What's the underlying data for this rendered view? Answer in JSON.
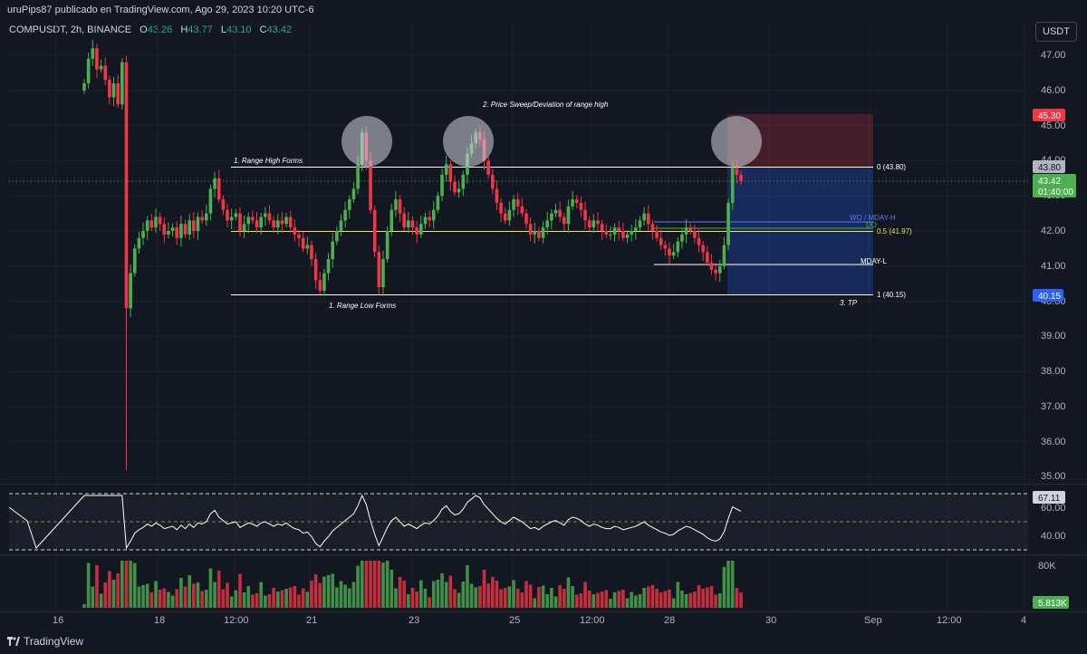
{
  "header": {
    "published_text": "uruPips87 publicado en TradingView.com, Ago 29, 2023 10:20 UTC-6",
    "symbol": "COMPUSDT, 2h, BINANCE",
    "ohlc": [
      {
        "k": "O",
        "v": "43.26"
      },
      {
        "k": "H",
        "v": "43.77"
      },
      {
        "k": "L",
        "v": "43.10"
      },
      {
        "k": "C",
        "v": "43.42"
      }
    ],
    "currency_button": "USDT"
  },
  "brand": {
    "name": "TradingView"
  },
  "colors": {
    "up": "#4caf50",
    "down": "#f23645",
    "background": "#131722",
    "accent": "#2962ff"
  },
  "price_axis": {
    "labels": [
      "47.00",
      "46.00",
      "45.00",
      "44.00",
      "43.00",
      "42.00",
      "41.00",
      "40.00",
      "39.00",
      "38.00",
      "37.00",
      "36.00",
      "35.00"
    ],
    "badges": {
      "stop": "45.30",
      "entry": "43.80",
      "last_price": "43.42",
      "countdown": "01:40:00",
      "target": "40.15"
    }
  },
  "time_axis": {
    "labels": [
      "16",
      "18",
      "12:00",
      "21",
      "23",
      "25",
      "12:00",
      "28",
      "30",
      "Sep",
      "12:00",
      "4"
    ]
  },
  "annotations": {
    "range_high": "1. Range High Forms",
    "range_low": "1. Range Low Forms",
    "sweep": "2. Price Sweep/Deviation of range high",
    "tp": "3. TP",
    "fib_0": "0 (43.80)",
    "fib_05": "0.5 (41.97)",
    "fib_1": "1 (40.15)",
    "wo_mday_h": "WO / MDAY-H",
    "do": "DO",
    "mday_l": "MDAY-L"
  },
  "rsi": {
    "labels": [
      "60.00",
      "40.00"
    ],
    "value": "67.11"
  },
  "volume": {
    "label": "80K",
    "value": "5.813K"
  },
  "chart_data": {
    "type": "candlestick",
    "symbol": "COMPUSDT",
    "timeframe": "2h",
    "exchange": "BINANCE",
    "ylim": [
      35.0,
      47.5
    ],
    "levels": {
      "range_high": 43.8,
      "equilibrium": 41.97,
      "range_low": 40.15,
      "stop": 45.3,
      "wo_mday_h": 42.25,
      "do": 42.05,
      "mday_l": 41.0
    },
    "close_series": [
      46.2,
      46.9,
      47.2,
      46.6,
      46.7,
      46.3,
      45.8,
      46.2,
      45.6,
      46.8,
      39.8,
      40.8,
      41.5,
      41.8,
      42.0,
      42.3,
      42.1,
      42.4,
      42.2,
      41.9,
      42.0,
      42.1,
      41.8,
      42.2,
      41.9,
      42.3,
      42.0,
      42.4,
      42.3,
      42.5,
      43.2,
      43.5,
      42.9,
      42.6,
      42.3,
      42.4,
      42.5,
      42.0,
      42.2,
      42.4,
      42.3,
      42.1,
      42.4,
      42.5,
      42.3,
      42.1,
      42.3,
      42.2,
      42.4,
      42.1,
      41.9,
      41.8,
      41.5,
      41.6,
      41.2,
      40.6,
      40.3,
      40.8,
      41.2,
      41.7,
      42.0,
      42.3,
      42.6,
      42.9,
      43.2,
      43.9,
      44.8,
      44.0,
      42.6,
      41.4,
      40.4,
      41.2,
      42.0,
      42.6,
      42.9,
      42.5,
      42.1,
      42.3,
      42.1,
      41.9,
      42.2,
      42.4,
      42.3,
      42.6,
      43.0,
      43.6,
      43.9,
      43.4,
      43.1,
      43.2,
      43.6,
      44.2,
      44.5,
      44.8,
      44.6,
      44.0,
      43.6,
      43.2,
      42.8,
      42.5,
      42.3,
      42.6,
      42.9,
      42.7,
      42.5,
      42.2,
      41.9,
      42.0,
      41.8,
      42.1,
      42.3,
      42.5,
      42.6,
      42.4,
      42.2,
      42.7,
      42.9,
      42.8,
      42.6,
      42.3,
      42.1,
      42.3,
      42.2,
      42.0,
      41.9,
      41.9,
      42.1,
      42.0,
      41.8,
      41.9,
      42.0,
      42.1,
      42.3,
      42.5,
      42.2,
      42.0,
      41.8,
      41.6,
      41.5,
      41.3,
      41.4,
      41.7,
      41.9,
      42.1,
      42.0,
      41.8,
      41.6,
      41.4,
      41.1,
      40.9,
      40.8,
      41.0,
      41.6,
      42.8,
      43.8,
      43.6,
      43.42
    ]
  }
}
